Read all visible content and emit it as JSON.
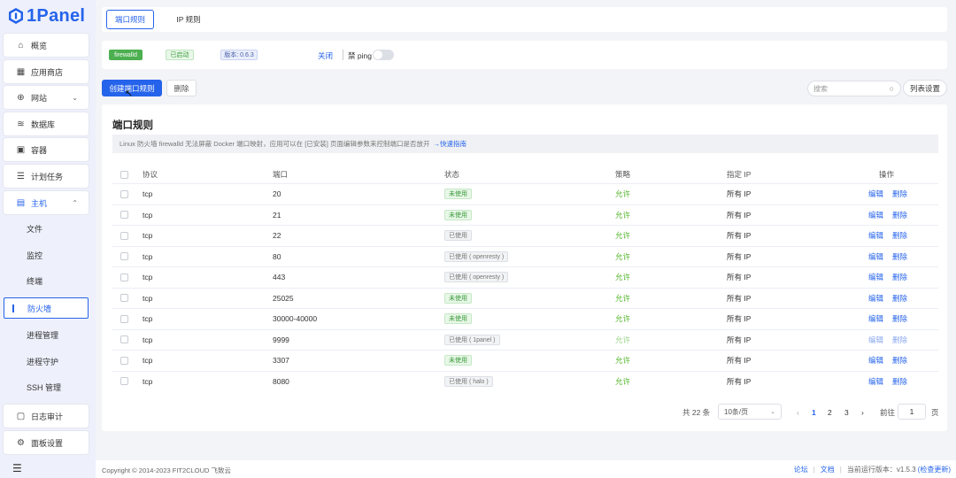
{
  "app": {
    "logo_text": "1Panel"
  },
  "sidebar": {
    "items": [
      {
        "label": "概览",
        "icon": "home-icon"
      },
      {
        "label": "应用商店",
        "icon": "grid-icon"
      },
      {
        "label": "网站",
        "icon": "globe-icon"
      },
      {
        "label": "数据库",
        "icon": "database-icon"
      },
      {
        "label": "容器",
        "icon": "container-icon"
      },
      {
        "label": "计划任务",
        "icon": "list-icon"
      },
      {
        "label": "主机",
        "icon": "server-icon"
      }
    ],
    "host_submenu": [
      "文件",
      "监控",
      "终端",
      "防火墙",
      "进程管理",
      "进程守护",
      "SSH 管理"
    ],
    "bottom_items": [
      {
        "label": "日志审计",
        "icon": "log-icon"
      },
      {
        "label": "面板设置",
        "icon": "settings-icon"
      }
    ]
  },
  "tabs": [
    "端口规则",
    "IP 规则"
  ],
  "status": {
    "firewall_tag": "firewalld",
    "started_tag": "已启动",
    "version_tag": "版本: 0.6.3",
    "close_link": "关闭",
    "ping_label": "禁 ping",
    "ping_disabled": false
  },
  "toolbar": {
    "create_label": "创建端口规则",
    "delete_label": "删除",
    "search_placeholder": "搜索",
    "columns_label": "列表设置"
  },
  "content": {
    "title": "端口规则",
    "notice": "Linux 防火墙 firewalld 无法屏蔽 Docker 端口映射，应用可以在 [已安装] 页面编辑参数来控制端口是否放开",
    "notice_link": "快速指南",
    "columns": [
      "协议",
      "端口",
      "状态",
      "策略",
      "指定 IP",
      "操作"
    ],
    "rows": [
      {
        "protocol": "tcp",
        "port": "20",
        "status": "未使用",
        "used": false,
        "strategy": "允许",
        "ip": "所有 IP"
      },
      {
        "protocol": "tcp",
        "port": "21",
        "status": "未使用",
        "used": false,
        "strategy": "允许",
        "ip": "所有 IP"
      },
      {
        "protocol": "tcp",
        "port": "22",
        "status": "已使用",
        "used": true,
        "strategy": "允许",
        "ip": "所有 IP"
      },
      {
        "protocol": "tcp",
        "port": "80",
        "status": "已使用 ( openresty )",
        "used": true,
        "strategy": "允许",
        "ip": "所有 IP"
      },
      {
        "protocol": "tcp",
        "port": "443",
        "status": "已使用 ( openresty )",
        "used": true,
        "strategy": "允许",
        "ip": "所有 IP"
      },
      {
        "protocol": "tcp",
        "port": "25025",
        "status": "未使用",
        "used": false,
        "strategy": "允许",
        "ip": "所有 IP"
      },
      {
        "protocol": "tcp",
        "port": "30000-40000",
        "status": "未使用",
        "used": false,
        "strategy": "允许",
        "ip": "所有 IP"
      },
      {
        "protocol": "tcp",
        "port": "9999",
        "status": "已使用 ( 1panel )",
        "used": true,
        "strategy": "允许",
        "ip": "所有 IP"
      },
      {
        "protocol": "tcp",
        "port": "3307",
        "status": "未使用",
        "used": false,
        "strategy": "允许",
        "ip": "所有 IP"
      },
      {
        "protocol": "tcp",
        "port": "8080",
        "status": "已使用 ( halo )",
        "used": true,
        "strategy": "允许",
        "ip": "所有 IP"
      }
    ],
    "actions": [
      "编辑",
      "删除"
    ]
  },
  "pagination": {
    "total": "共 22 条",
    "page_size": "10条/页",
    "pages": [
      "1",
      "2",
      "3"
    ],
    "goto_label": "前往",
    "current": "1",
    "page_suffix": "页"
  },
  "footer": {
    "copyright": "Copyright © 2014-2023 FIT2CLOUD 飞致云",
    "forum": "论坛",
    "docs": "文档",
    "version_label": "当前运行版本：v1.5.3",
    "check_update": "(检查更新)"
  },
  "colors": {
    "primary": "#2563eb",
    "success": "#52b52a",
    "sidebar_bg": "#eef0fb"
  }
}
